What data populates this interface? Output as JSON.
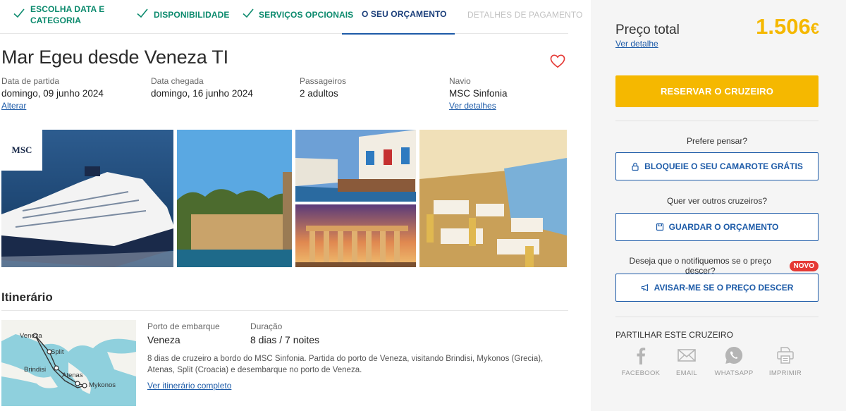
{
  "steps": [
    {
      "label": "ESCOLHA DATA E CATEGORIA",
      "state": "done"
    },
    {
      "label": "DISPONIBILIDADE",
      "state": "done"
    },
    {
      "label": "SERVIÇOS OPCIONAIS",
      "state": "done"
    },
    {
      "label": "O SEU ORÇAMENTO",
      "state": "active"
    },
    {
      "label": "DETALHES DE PAGAMENTO",
      "state": "pending"
    }
  ],
  "cruise": {
    "title": "Mar Egeu desde Veneza TI",
    "favorite_icon": "heart-icon",
    "departure_label": "Data de partida",
    "departure_value": "domingo, 09 junho 2024",
    "departure_link": "Alterar",
    "arrival_label": "Data chegada",
    "arrival_value": "domingo, 16 junho 2024",
    "passengers_label": "Passageiros",
    "passengers_value": "2 adultos",
    "ship_label": "Navio",
    "ship_value": "MSC Sinfonia",
    "ship_link": "Ver detalhes",
    "logo_text": "MSC"
  },
  "itinerary": {
    "title": "Itinerário",
    "map_labels": [
      "Veneza",
      "Split",
      "Brindisi",
      "Atenas",
      "Mykonos"
    ],
    "port_label": "Porto de embarque",
    "port_value": "Veneza",
    "duration_label": "Duração",
    "duration_value": "8 dias / 7 noites",
    "description": "8 dias de cruzeiro a bordo do MSC Sinfonia. Partida do porto de Veneza, visitando Brindisi, Mykonos (Grecia), Atenas, Split (Croacia) e desembarque no porto de Veneza.",
    "full_link": "Ver itinerário completo"
  },
  "sidebar": {
    "price_label": "Preço total",
    "price_detail_link": "Ver detalhe",
    "price_value": "1.506",
    "currency": "€",
    "book_button": "RESERVAR O CRUZEIRO",
    "think_question": "Prefere pensar?",
    "block_button": "BLOQUEIE O SEU CAMAROTE GRÁTIS",
    "other_question": "Quer ver outros cruzeiros?",
    "save_button": "GUARDAR O ORÇAMENTO",
    "notify_question": "Deseja que o notifiquemos se o preço descer?",
    "new_badge": "NOVO",
    "notify_button": "AVISAR-ME SE O PREÇO DESCER",
    "share_title": "PARTILHAR ESTE CRUZEIRO",
    "share": [
      {
        "label": "FACEBOOK",
        "icon": "facebook-icon"
      },
      {
        "label": "EMAIL",
        "icon": "email-icon"
      },
      {
        "label": "WHATSAPP",
        "icon": "whatsapp-icon"
      },
      {
        "label": "IMPRIMIR",
        "icon": "print-icon"
      }
    ]
  },
  "colors": {
    "accent_yellow": "#f5b800",
    "link_blue": "#1d5ba8",
    "done_green": "#0b8a6d",
    "badge_red": "#e53935"
  }
}
